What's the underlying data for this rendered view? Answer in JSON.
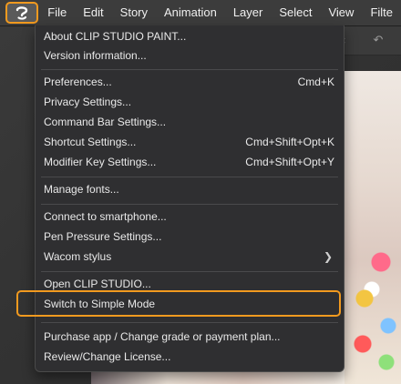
{
  "menubar": {
    "app_icon": "clip-studio-logo-icon",
    "items": [
      "File",
      "Edit",
      "Story",
      "Animation",
      "Layer",
      "Select",
      "View",
      "Filte"
    ]
  },
  "dropdown": {
    "groups": [
      [
        {
          "label": "About CLIP STUDIO PAINT...",
          "shortcut": ""
        },
        {
          "label": "Version information...",
          "shortcut": ""
        }
      ],
      [
        {
          "label": "Preferences...",
          "shortcut": "Cmd+K"
        },
        {
          "label": "Privacy Settings...",
          "shortcut": ""
        },
        {
          "label": "Command Bar Settings...",
          "shortcut": ""
        },
        {
          "label": "Shortcut Settings...",
          "shortcut": "Cmd+Shift+Opt+K"
        },
        {
          "label": "Modifier Key Settings...",
          "shortcut": "Cmd+Shift+Opt+Y"
        }
      ],
      [
        {
          "label": "Manage fonts...",
          "shortcut": ""
        }
      ],
      [
        {
          "label": "Connect to smartphone...",
          "shortcut": ""
        },
        {
          "label": "Pen Pressure Settings...",
          "shortcut": ""
        },
        {
          "label": "Wacom stylus",
          "shortcut": "",
          "submenu_icon": "chevron-right-icon"
        }
      ],
      [
        {
          "label": "Open CLIP STUDIO...",
          "shortcut": ""
        },
        {
          "label": "Switch to Simple Mode",
          "shortcut": "",
          "highlighted": true
        }
      ],
      [
        {
          "label": "Purchase app / Change grade or payment plan...",
          "shortcut": ""
        },
        {
          "label": "Review/Change License...",
          "shortcut": ""
        }
      ]
    ]
  },
  "toolbar_icons": [
    "chevron-updown-icon",
    "undo-icon"
  ],
  "colors": {
    "accent_highlight": "#f29a1f",
    "menu_bg": "#2f2f31",
    "menubar_bg": "#3c3c3c"
  }
}
